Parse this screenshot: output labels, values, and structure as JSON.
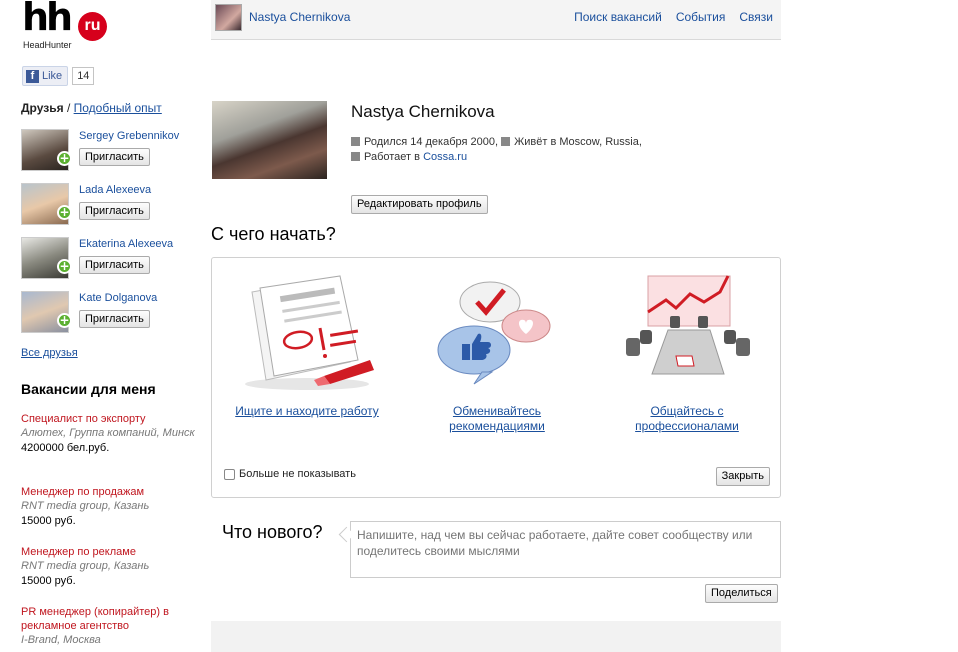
{
  "logo": {
    "main": "hh",
    "badge": "ru",
    "sub": "HeadHunter"
  },
  "facebook": {
    "like_label": "Like",
    "count": "14",
    "icon": "f"
  },
  "friends": {
    "heading": "Друзья",
    "separator": "/",
    "similar_link": "Подобный опыт",
    "items": [
      {
        "name": "Sergey Grebennikov",
        "button": "Пригласить"
      },
      {
        "name": "Lada Alexeeva",
        "button": "Пригласить"
      },
      {
        "name": "Ekaterina Alexeeva",
        "button": "Пригласить"
      },
      {
        "name": "Kate Dolganova",
        "button": "Пригласить"
      }
    ],
    "all_link": "Все друзья"
  },
  "vacancies": {
    "heading": "Вакансии для меня",
    "items": [
      {
        "title": "Специалист по экспорту",
        "company": "Алютех, Группа компаний, Минск",
        "salary": "4200000 бел.руб."
      },
      {
        "title": "Менеджер по продажам",
        "company": "RNT media group, Казань",
        "salary": "15000 руб."
      },
      {
        "title": "Менеджер по рекламе",
        "company": "RNT media group, Казань",
        "salary": "15000 руб."
      },
      {
        "title": "PR менеджер (копирайтер) в рекламное агентство",
        "company": "I-Brand, Москва",
        "salary": ""
      }
    ]
  },
  "topbar": {
    "user_name": "Nastya Chernikova",
    "nav": [
      "Поиск вакансий",
      "События",
      "Связи"
    ]
  },
  "profile": {
    "name": "Nastya Chernikova",
    "born": "Родился 14 декабря 2000,",
    "lives": "Живёт в Moscow, Russia,",
    "works_prefix": "Работает в",
    "works_company": "Cossa.ru",
    "edit_button": "Редактировать профиль"
  },
  "getting_started": {
    "heading": "С чего начать?",
    "cards": [
      {
        "label": "Ищите и находите работу",
        "icon": "newspaper-icon"
      },
      {
        "label": "Обменивайтесь рекомендациями",
        "icon": "chat-bubbles-icon"
      },
      {
        "label": "Общайтесь с профессионалами",
        "icon": "meeting-chart-icon"
      }
    ],
    "dont_show": "Больше не показывать",
    "close_button": "Закрыть"
  },
  "status": {
    "heading": "Что нового?",
    "placeholder": "Напишите, над чем вы сейчас работаете, дайте совет сообществу или поделитесь своими мыслями",
    "share_button": "Поделиться"
  },
  "colors": {
    "link": "#1a4f9c",
    "vacancy_title": "#c0161f",
    "logo_red": "#d6001c",
    "plus_green": "#5bb030"
  }
}
